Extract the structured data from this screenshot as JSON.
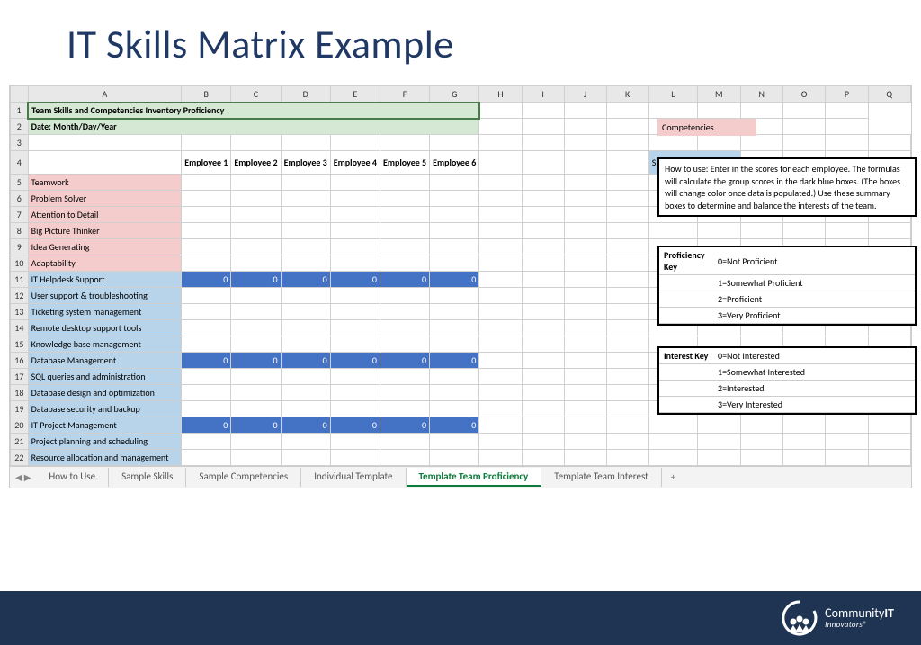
{
  "title": "IT Skills Matrix Example",
  "columns": [
    "A",
    "B",
    "C",
    "D",
    "E",
    "F",
    "G",
    "H",
    "I",
    "J",
    "K",
    "L",
    "M",
    "N",
    "O",
    "P",
    "Q"
  ],
  "row1": "Team Skills and Competencies Inventory Proficiency",
  "row2": "Date: Month/Day/Year",
  "emp_headers": [
    "Employee 1",
    "Employee 2",
    "Employee 3",
    "Employee 4",
    "Employee 5",
    "Employee 6"
  ],
  "legend": {
    "skills": "Skills",
    "competencies": "Competencies"
  },
  "howto": "How to use: Enter in the scores for each employee. The formulas will calculate the group scores in the dark blue boxes. (The boxes will change color once data is populated.) Use these summary boxes to determine and balance the interests of the team.",
  "rows": [
    {
      "n": 5,
      "label": "Teamwork",
      "cls": "peach"
    },
    {
      "n": 6,
      "label": "Problem Solver",
      "cls": "peach"
    },
    {
      "n": 7,
      "label": "Attention to Detail",
      "cls": "peach"
    },
    {
      "n": 8,
      "label": "Big Picture Thinker",
      "cls": "peach"
    },
    {
      "n": 9,
      "label": "Idea Generating",
      "cls": "peach"
    },
    {
      "n": 10,
      "label": "Adaptability",
      "cls": "peach"
    },
    {
      "n": 11,
      "label": "IT Helpdesk Support",
      "cls": "lightblue",
      "sum": true
    },
    {
      "n": 12,
      "label": "User support & troubleshooting",
      "cls": "lightblue"
    },
    {
      "n": 13,
      "label": "Ticketing system management",
      "cls": "lightblue"
    },
    {
      "n": 14,
      "label": "Remote desktop support tools",
      "cls": "lightblue"
    },
    {
      "n": 15,
      "label": "Knowledge base management",
      "cls": "lightblue"
    },
    {
      "n": 16,
      "label": "Database Management",
      "cls": "lightblue",
      "sum": true
    },
    {
      "n": 17,
      "label": "SQL queries and administration",
      "cls": "lightblue"
    },
    {
      "n": 18,
      "label": "Database design and optimization",
      "cls": "lightblue"
    },
    {
      "n": 19,
      "label": "Database security and backup",
      "cls": "lightblue"
    },
    {
      "n": 20,
      "label": "IT Project Management",
      "cls": "lightblue",
      "sum": true
    },
    {
      "n": 21,
      "label": "Project planning and scheduling",
      "cls": "lightblue"
    },
    {
      "n": 22,
      "label": "Resource allocation and management",
      "cls": "lightblue"
    }
  ],
  "prof_key": {
    "title": "Proficiency Key",
    "items": [
      "0=Not Proficient",
      "1=Somewhat Proficient",
      "2=Proficient",
      "3=Very Proficient"
    ]
  },
  "interest_key": {
    "title": "Interest Key",
    "items": [
      "0=Not Interested",
      "1=Somewhat Interested",
      "2=Interested",
      "3=Very Interested"
    ]
  },
  "tabs": [
    "How to Use",
    "Sample Skills",
    "Sample Competencies",
    "Individual Template",
    "Template Team Proficiency",
    "Template Team Interest"
  ],
  "active_tab": 4,
  "logo": {
    "name": "CommunityIT",
    "sub": "Innovators®"
  },
  "zero": "0"
}
